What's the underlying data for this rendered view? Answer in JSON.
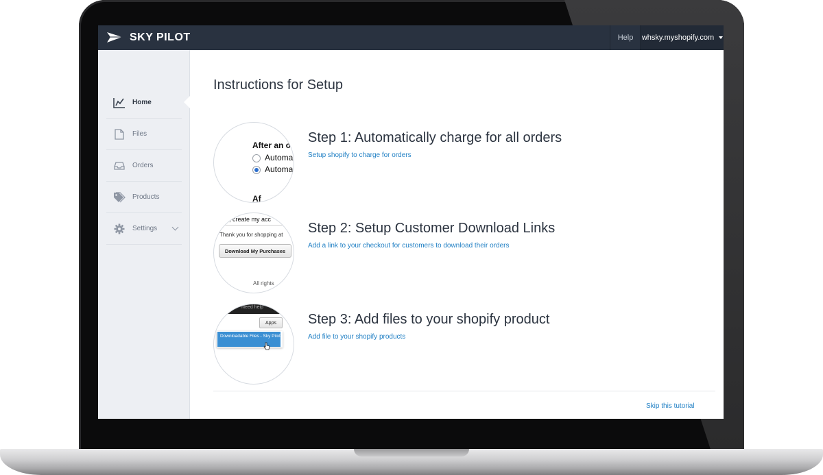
{
  "brand": {
    "name": "SKY PILOT"
  },
  "topbar": {
    "help_label": "Help",
    "shop_label": "whsky.myshopify.com"
  },
  "sidebar": {
    "items": [
      {
        "label": "Home",
        "icon": "chart-icon"
      },
      {
        "label": "Files",
        "icon": "file-icon"
      },
      {
        "label": "Orders",
        "icon": "inbox-icon"
      },
      {
        "label": "Products",
        "icon": "tag-icon"
      },
      {
        "label": "Settings",
        "icon": "gear-icon"
      }
    ]
  },
  "main": {
    "title": "Instructions for Setup",
    "steps": [
      {
        "title": "Step 1: Automatically charge for all orders",
        "link": "Setup shopify to charge for orders",
        "thumb": {
          "heading": "After an o",
          "option1": "Automa",
          "option2": "Automa",
          "footer": "Af"
        }
      },
      {
        "title": "Step 2: Setup Customer Download Links",
        "link": "Add a link to your checkout for customers to download their orders",
        "thumb": {
          "top": ", create my acc",
          "line": "Thank you for shopping at",
          "button": "Download My Purchases",
          "footer": "All rights"
        }
      },
      {
        "title": "Step 3: Add files to your shopify product",
        "link": "Add file to your shopify products",
        "thumb": {
          "top": "Need help",
          "button": "Apps",
          "menu_item": "Downloadable Files - Sky Pilot"
        }
      }
    ],
    "skip_label": "Skip this tutorial"
  },
  "colors": {
    "topbar": "#293240",
    "link": "#1f7fc4",
    "sidebar": "#edeff3"
  }
}
